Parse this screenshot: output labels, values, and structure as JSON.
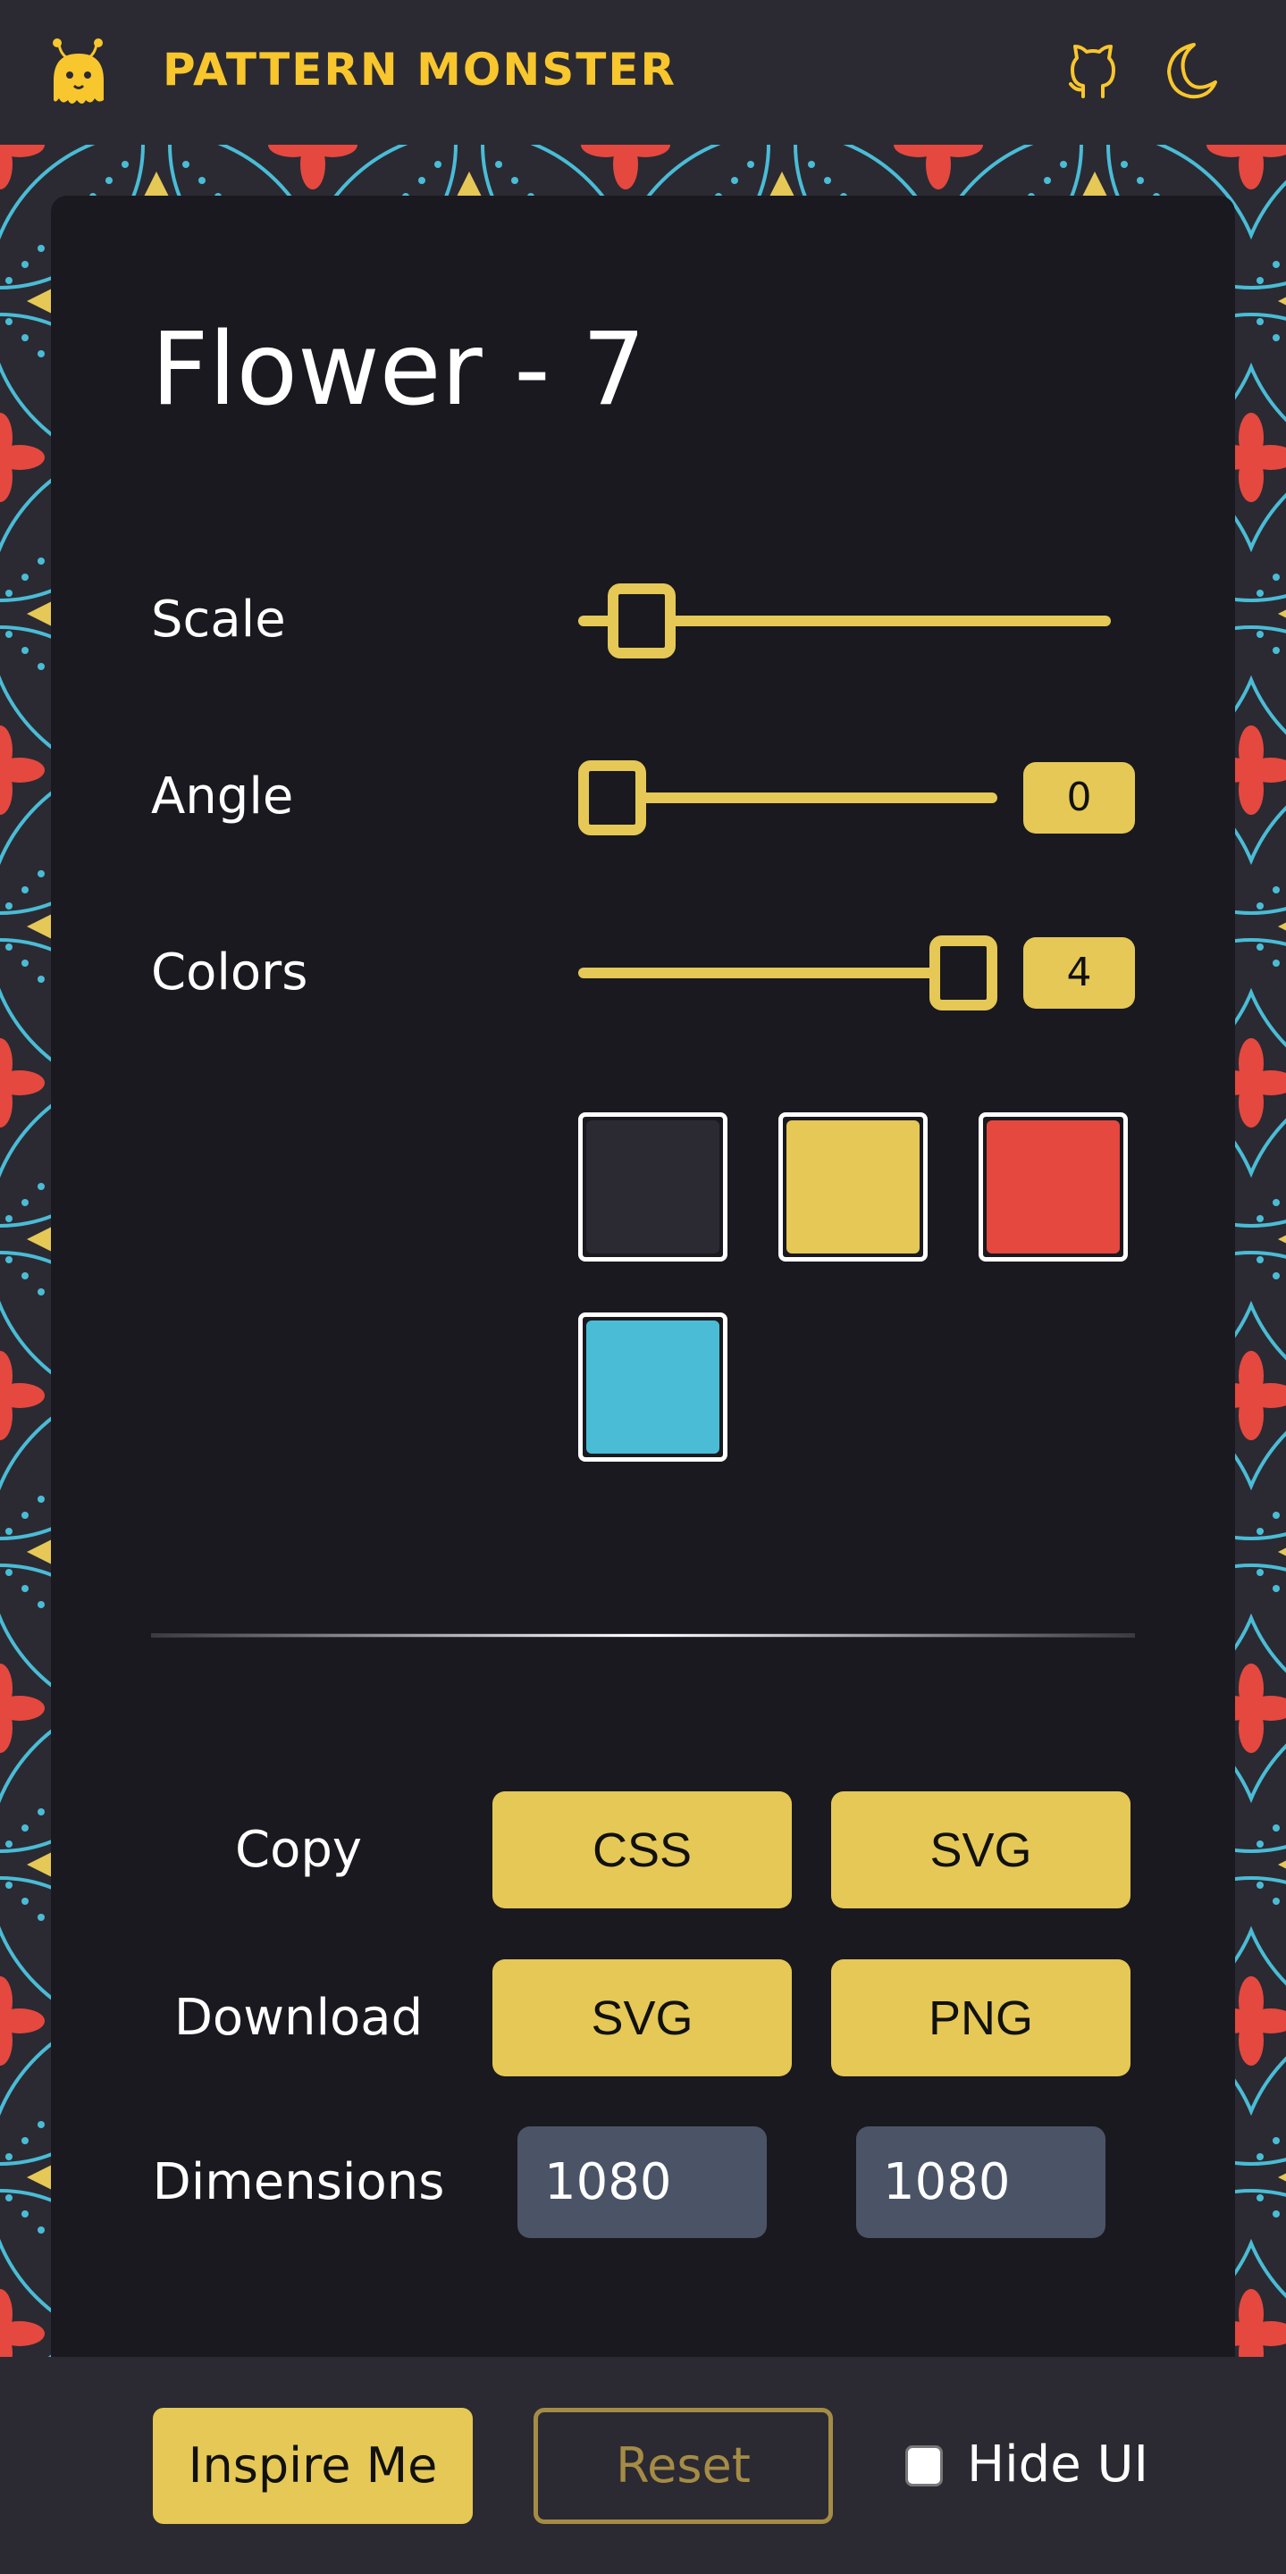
{
  "header": {
    "brand": "PATTERN MONSTER",
    "logo_icon": "monster-logo-icon",
    "github_icon": "github-icon",
    "theme_icon": "moon-icon"
  },
  "editor": {
    "title": "Flower - 7",
    "controls": {
      "scale": {
        "label": "Scale",
        "value_fraction": 0.07
      },
      "angle": {
        "label": "Angle",
        "value": "0",
        "value_fraction": 0.0
      },
      "colors": {
        "label": "Colors",
        "value": "4",
        "value_fraction": 1.0
      }
    },
    "palette": {
      "colors": [
        "#2b2a33",
        "#e5c856",
        "#e5483f",
        "#4abcd6"
      ]
    },
    "copy": {
      "label": "Copy",
      "css": "CSS",
      "svg": "SVG"
    },
    "download": {
      "label": "Download",
      "svg": "SVG",
      "png": "PNG"
    },
    "dimensions": {
      "label": "Dimensions",
      "width": "1080",
      "height": "1080"
    }
  },
  "footer": {
    "inspire": "Inspire Me",
    "reset": "Reset",
    "hide_ui": "Hide UI",
    "hide_ui_checked": false
  },
  "theme": {
    "accent": "#e5c856",
    "brand": "#f8c62d",
    "background": "#2b2a32",
    "panel": "#1a191f"
  }
}
